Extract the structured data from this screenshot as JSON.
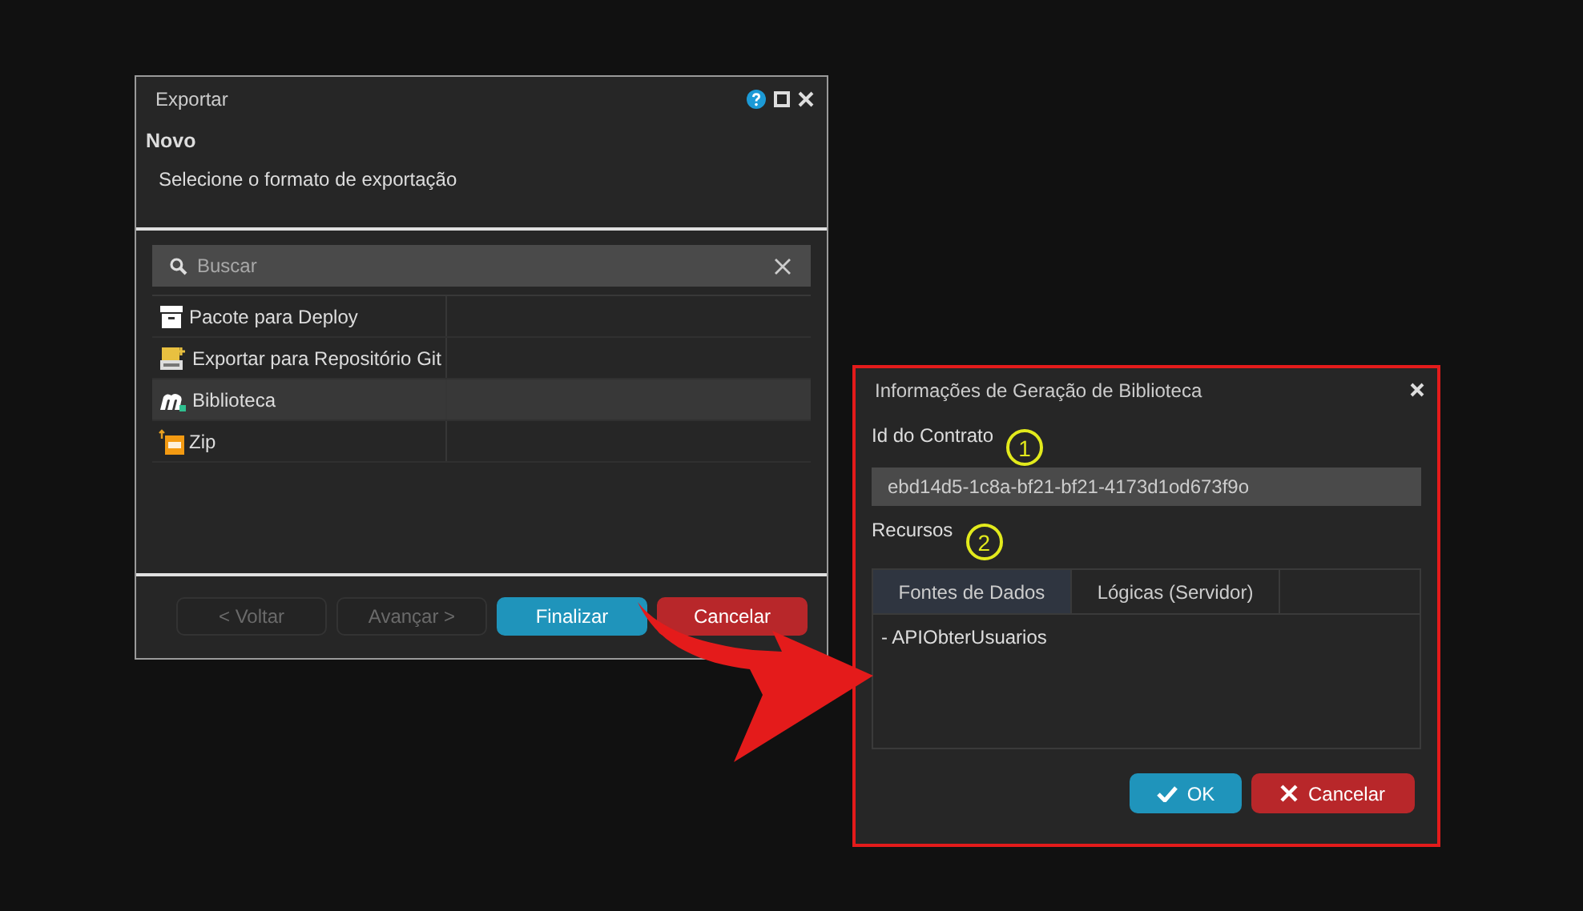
{
  "export_dialog": {
    "title": "Exportar",
    "heading": "Novo",
    "instruction": "Selecione o formato de exportação",
    "search": {
      "placeholder": "Buscar"
    },
    "formats": [
      {
        "label": "Pacote para Deploy",
        "kind": "package",
        "selected": false
      },
      {
        "label": "Exportar para Repositório Git",
        "kind": "git",
        "selected": false
      },
      {
        "label": "Biblioteca",
        "kind": "library",
        "selected": true
      },
      {
        "label": "Zip",
        "kind": "zip",
        "selected": false
      }
    ],
    "buttons": [
      {
        "label": "< Voltar",
        "kind": "secondary",
        "disabled": true
      },
      {
        "label": "Avançar >",
        "kind": "secondary",
        "disabled": true
      },
      {
        "label": "Finalizar",
        "kind": "primary",
        "disabled": false
      },
      {
        "label": "Cancelar",
        "kind": "danger",
        "disabled": false
      }
    ]
  },
  "library_dialog": {
    "title": "Informações de Geração de Biblioteca",
    "contract_label": "Id do Contrato",
    "contract_marker": "1",
    "contract_id": "ebd14d5-1c8a-bf21-bf21-4173d1od673f9o",
    "resources_label": "Recursos",
    "resources_marker": "2",
    "tabs": [
      {
        "label": "Fontes de Dados",
        "selected": true
      },
      {
        "label": "Lógicas (Servidor)",
        "selected": false
      }
    ],
    "resources": [
      "- APIObterUsuarios"
    ],
    "buttons": [
      {
        "label": "OK",
        "kind": "confirm"
      },
      {
        "label": "Cancelar",
        "kind": "cancel"
      }
    ]
  }
}
